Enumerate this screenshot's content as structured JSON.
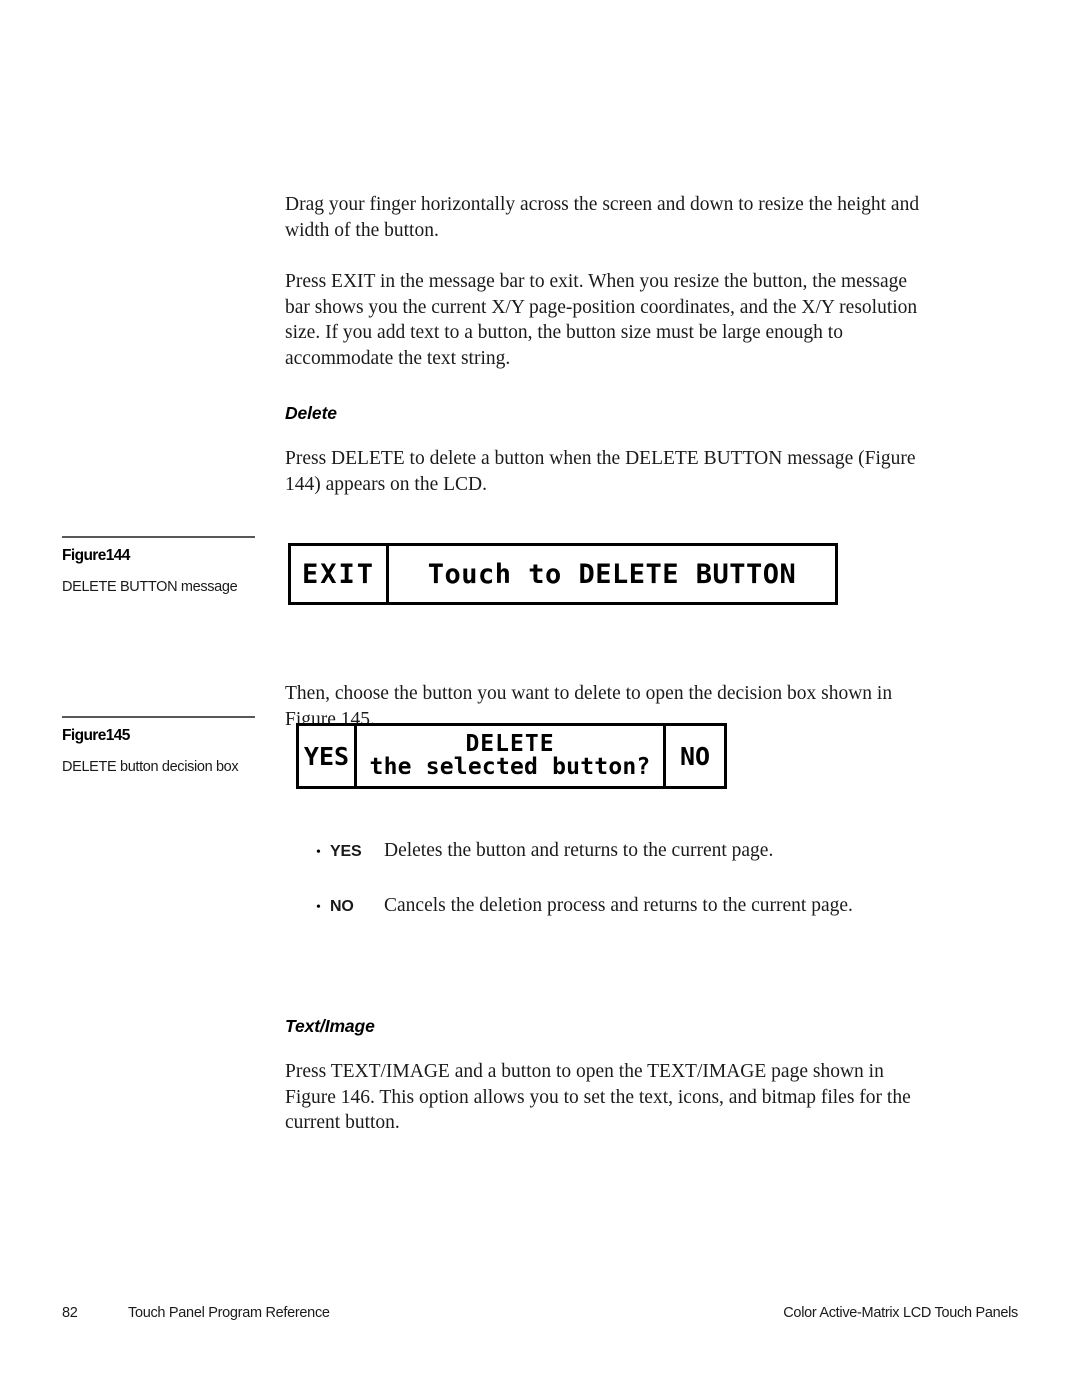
{
  "document": {
    "body_paragraphs": [
      "Drag your finger horizontally across the screen and down to resize the height and width of the button.",
      "Press EXIT in the message bar to exit. When you resize the button, the message bar shows you the current X/Y page-position coordinates, and the X/Y resolution size. If you add text to a button, the button size must be large enough to accommodate the text string."
    ],
    "delete_section": {
      "heading": "Delete",
      "intro": "Press DELETE to delete a button when the DELETE BUTTON message (Figure 144) appears on the LCD.",
      "after_figure144": "Then, choose the button you want to delete to open the decision box shown in Figure 145."
    },
    "text_image_section": {
      "heading": "Text/Image",
      "paragraph": "Press TEXT/IMAGE and a button to open the TEXT/IMAGE page shown in Figure 146. This option allows you to set the text, icons, and bitmap files for the current button."
    }
  },
  "figure144": {
    "number": "Figure144",
    "description": "DELETE BUTTON message",
    "lcd": {
      "exit_label": "EXIT",
      "message": "Touch to DELETE BUTTON"
    }
  },
  "figure145": {
    "number": "Figure145",
    "description": "DELETE button decision box",
    "lcd": {
      "yes_label": "YES",
      "prompt_line1": "DELETE",
      "prompt_line2": "the selected button?",
      "no_label": "NO"
    }
  },
  "bullets": [
    {
      "bullet": "•",
      "key": "YES",
      "text": "Deletes the button and returns to the current page."
    },
    {
      "bullet": "•",
      "key": "NO",
      "text": "Cancels the deletion process and returns to the current page."
    }
  ],
  "footer": {
    "page_number": "82",
    "left_title": "Touch Panel Program Reference",
    "right_title": "Color Active-Matrix LCD Touch Panels"
  },
  "colors": {
    "text": "#1a1a1a",
    "rule": "#58585a",
    "lcd_border": "#000000"
  }
}
